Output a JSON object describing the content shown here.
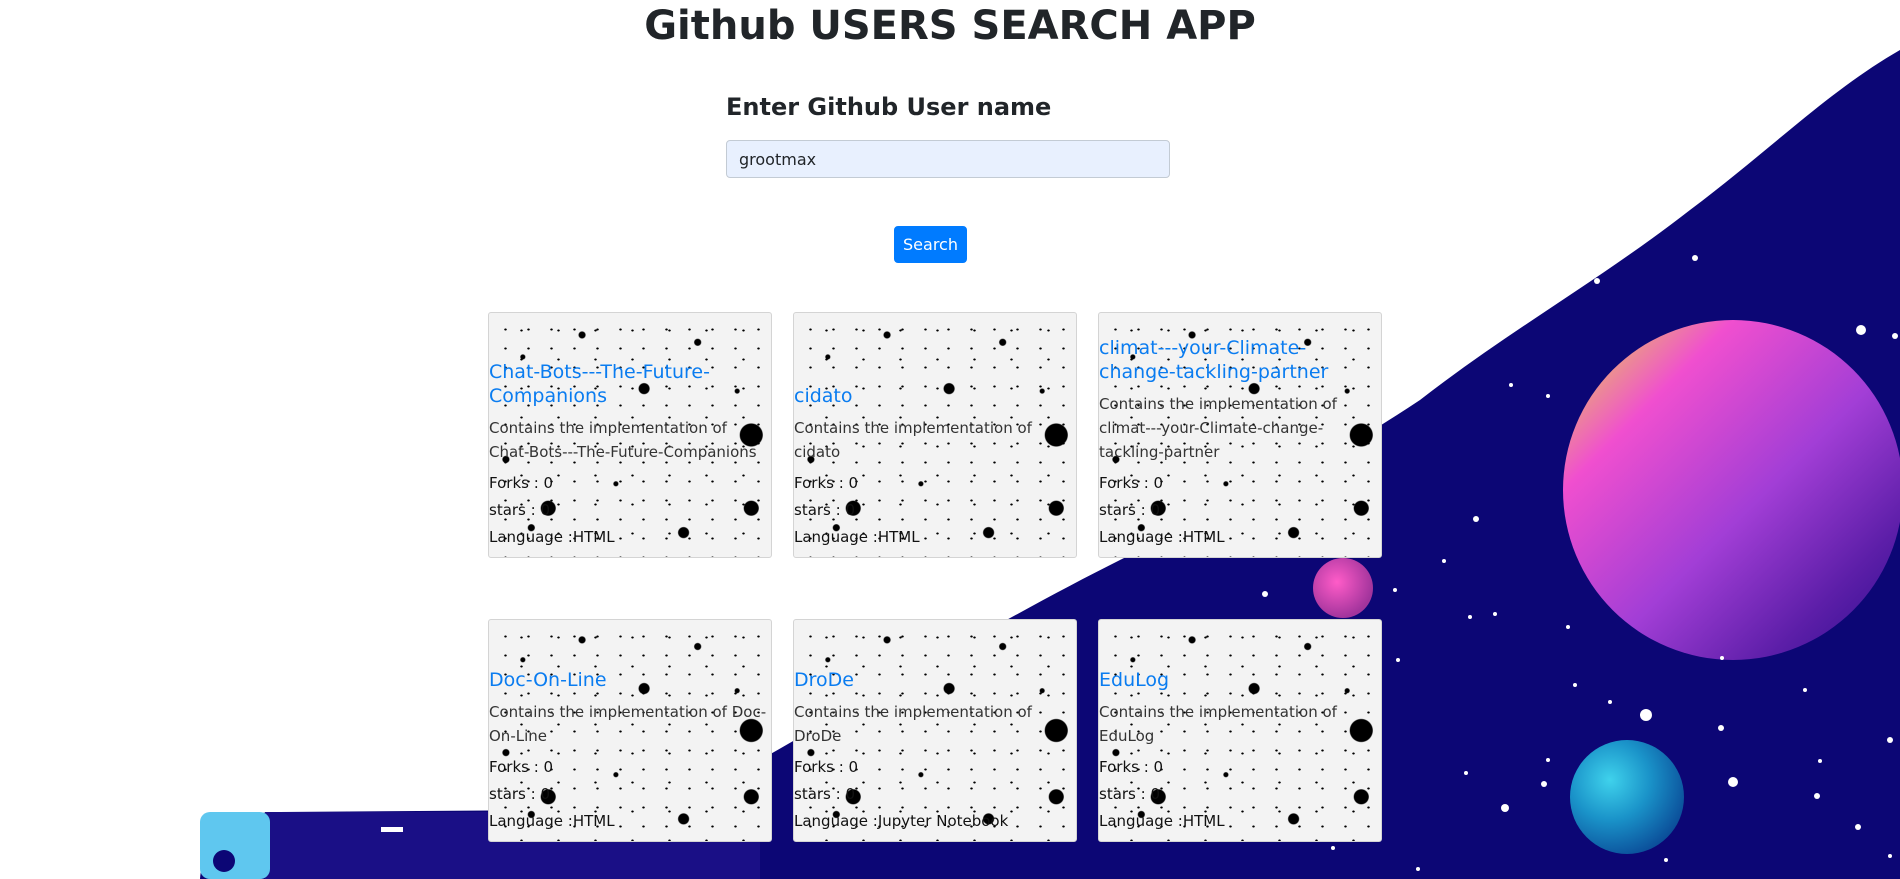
{
  "header": {
    "title": "Github USERS SEARCH APP"
  },
  "form": {
    "label": "Enter Github User name",
    "input_value": "grootmax",
    "button_label": "Search"
  },
  "repos": [
    {
      "name": "Chat-Bots---The-Future-Companions",
      "description": "Contains the implementation of Chat-Bots---The-Future-Companions",
      "forks": "Forks : 0",
      "stars": "stars : 0",
      "language": "Language :HTML"
    },
    {
      "name": "cidato",
      "description": "Contains the implementation of cidato",
      "forks": "Forks : 0",
      "stars": "stars : 0",
      "language": "Language :HTML"
    },
    {
      "name": "climat---your-Climate-change-tackling-partner",
      "description": "Contains the implementation of climat---your-Climate-change-tackling-partner",
      "forks": "Forks : 0",
      "stars": "stars : 0",
      "language": "Language :HTML"
    },
    {
      "name": "Doc-On-Line",
      "description": "Contains the implementation of Doc-On-Line",
      "forks": "Forks : 0",
      "stars": "stars : 0",
      "language": "Language :HTML"
    },
    {
      "name": "DroDe",
      "description": "Contains the implementation of DroDe",
      "forks": "Forks : 0",
      "stars": "stars : 0",
      "language": "Language :Jupyter Notebook"
    },
    {
      "name": "EduLog",
      "description": "Contains the implementation of EduLog",
      "forks": "Forks : 0",
      "stars": "stars : 0",
      "language": "Language :HTML"
    }
  ],
  "theme": {
    "page_background": "#ffffff",
    "space_color": "#0c0675",
    "button_color": "#007bff",
    "link_color": "#0a7cf0",
    "input_background": "#e8f0fe"
  }
}
